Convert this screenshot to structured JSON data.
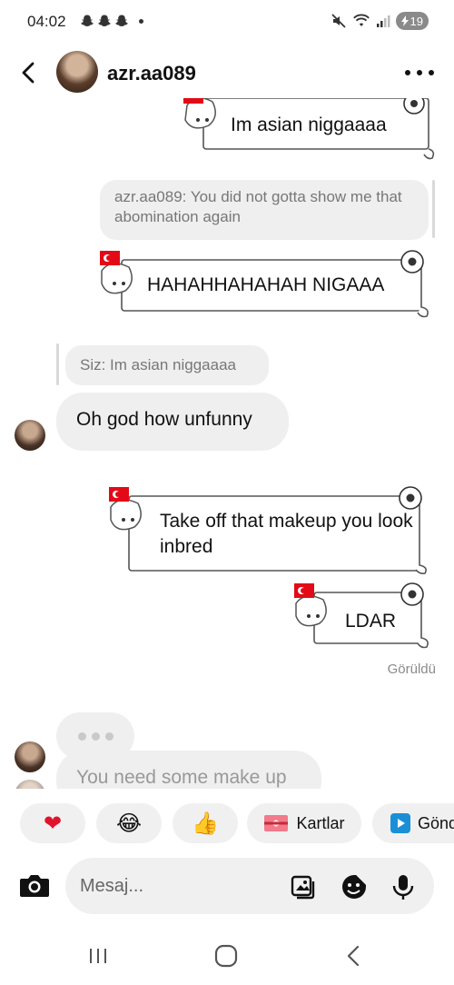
{
  "status_bar": {
    "time": "04:02",
    "battery": "19"
  },
  "header": {
    "username": "azr.aa089"
  },
  "messages": {
    "sticker_1_text": "Im asian niggaaaa",
    "reply_quote_1": "azr.aa089: You did not gotta show me that abomination again",
    "sticker_2_text": "HAHAHHAHAHAH NIGAAA",
    "reply_quote_2": "Siz: Im asian niggaaaa",
    "incoming_1": "Oh god how unfunny",
    "sticker_3_text": "Take off that makeup you look inbred",
    "sticker_4_text": "LDAR",
    "seen_label": "Görüldü",
    "incoming_2": "You need some make up"
  },
  "quick_replies": {
    "heart": "❤",
    "laugh": "😂",
    "thumbs_up": "👍",
    "cards_label": "Kartlar",
    "send_label": "Gönd"
  },
  "composer": {
    "placeholder": "Mesaj..."
  },
  "colors": {
    "bubble_gray": "#efefef",
    "sticker_flag_red": "#e30a17",
    "text_secondary": "#8a8a8a"
  }
}
